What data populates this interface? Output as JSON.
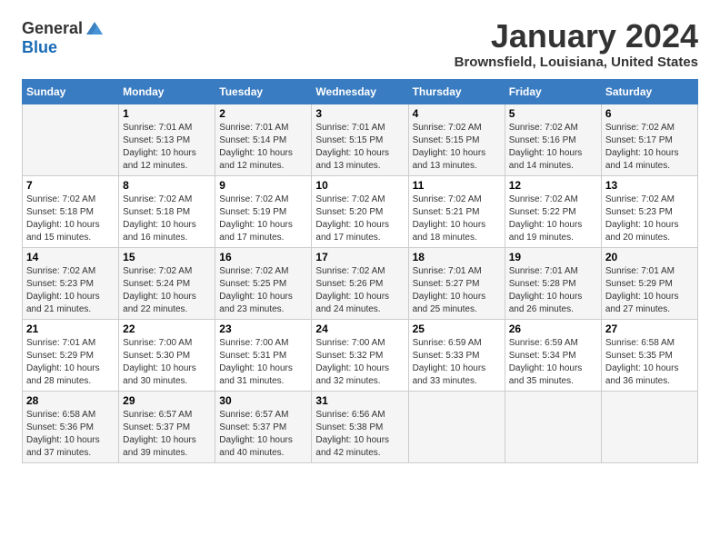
{
  "header": {
    "logo_general": "General",
    "logo_blue": "Blue",
    "month_year": "January 2024",
    "location": "Brownsfield, Louisiana, United States"
  },
  "weekdays": [
    "Sunday",
    "Monday",
    "Tuesday",
    "Wednesday",
    "Thursday",
    "Friday",
    "Saturday"
  ],
  "weeks": [
    [
      {
        "day": "",
        "info": ""
      },
      {
        "day": "1",
        "info": "Sunrise: 7:01 AM\nSunset: 5:13 PM\nDaylight: 10 hours\nand 12 minutes."
      },
      {
        "day": "2",
        "info": "Sunrise: 7:01 AM\nSunset: 5:14 PM\nDaylight: 10 hours\nand 12 minutes."
      },
      {
        "day": "3",
        "info": "Sunrise: 7:01 AM\nSunset: 5:15 PM\nDaylight: 10 hours\nand 13 minutes."
      },
      {
        "day": "4",
        "info": "Sunrise: 7:02 AM\nSunset: 5:15 PM\nDaylight: 10 hours\nand 13 minutes."
      },
      {
        "day": "5",
        "info": "Sunrise: 7:02 AM\nSunset: 5:16 PM\nDaylight: 10 hours\nand 14 minutes."
      },
      {
        "day": "6",
        "info": "Sunrise: 7:02 AM\nSunset: 5:17 PM\nDaylight: 10 hours\nand 14 minutes."
      }
    ],
    [
      {
        "day": "7",
        "info": "Sunrise: 7:02 AM\nSunset: 5:18 PM\nDaylight: 10 hours\nand 15 minutes."
      },
      {
        "day": "8",
        "info": "Sunrise: 7:02 AM\nSunset: 5:18 PM\nDaylight: 10 hours\nand 16 minutes."
      },
      {
        "day": "9",
        "info": "Sunrise: 7:02 AM\nSunset: 5:19 PM\nDaylight: 10 hours\nand 17 minutes."
      },
      {
        "day": "10",
        "info": "Sunrise: 7:02 AM\nSunset: 5:20 PM\nDaylight: 10 hours\nand 17 minutes."
      },
      {
        "day": "11",
        "info": "Sunrise: 7:02 AM\nSunset: 5:21 PM\nDaylight: 10 hours\nand 18 minutes."
      },
      {
        "day": "12",
        "info": "Sunrise: 7:02 AM\nSunset: 5:22 PM\nDaylight: 10 hours\nand 19 minutes."
      },
      {
        "day": "13",
        "info": "Sunrise: 7:02 AM\nSunset: 5:23 PM\nDaylight: 10 hours\nand 20 minutes."
      }
    ],
    [
      {
        "day": "14",
        "info": "Sunrise: 7:02 AM\nSunset: 5:23 PM\nDaylight: 10 hours\nand 21 minutes."
      },
      {
        "day": "15",
        "info": "Sunrise: 7:02 AM\nSunset: 5:24 PM\nDaylight: 10 hours\nand 22 minutes."
      },
      {
        "day": "16",
        "info": "Sunrise: 7:02 AM\nSunset: 5:25 PM\nDaylight: 10 hours\nand 23 minutes."
      },
      {
        "day": "17",
        "info": "Sunrise: 7:02 AM\nSunset: 5:26 PM\nDaylight: 10 hours\nand 24 minutes."
      },
      {
        "day": "18",
        "info": "Sunrise: 7:01 AM\nSunset: 5:27 PM\nDaylight: 10 hours\nand 25 minutes."
      },
      {
        "day": "19",
        "info": "Sunrise: 7:01 AM\nSunset: 5:28 PM\nDaylight: 10 hours\nand 26 minutes."
      },
      {
        "day": "20",
        "info": "Sunrise: 7:01 AM\nSunset: 5:29 PM\nDaylight: 10 hours\nand 27 minutes."
      }
    ],
    [
      {
        "day": "21",
        "info": "Sunrise: 7:01 AM\nSunset: 5:29 PM\nDaylight: 10 hours\nand 28 minutes."
      },
      {
        "day": "22",
        "info": "Sunrise: 7:00 AM\nSunset: 5:30 PM\nDaylight: 10 hours\nand 30 minutes."
      },
      {
        "day": "23",
        "info": "Sunrise: 7:00 AM\nSunset: 5:31 PM\nDaylight: 10 hours\nand 31 minutes."
      },
      {
        "day": "24",
        "info": "Sunrise: 7:00 AM\nSunset: 5:32 PM\nDaylight: 10 hours\nand 32 minutes."
      },
      {
        "day": "25",
        "info": "Sunrise: 6:59 AM\nSunset: 5:33 PM\nDaylight: 10 hours\nand 33 minutes."
      },
      {
        "day": "26",
        "info": "Sunrise: 6:59 AM\nSunset: 5:34 PM\nDaylight: 10 hours\nand 35 minutes."
      },
      {
        "day": "27",
        "info": "Sunrise: 6:58 AM\nSunset: 5:35 PM\nDaylight: 10 hours\nand 36 minutes."
      }
    ],
    [
      {
        "day": "28",
        "info": "Sunrise: 6:58 AM\nSunset: 5:36 PM\nDaylight: 10 hours\nand 37 minutes."
      },
      {
        "day": "29",
        "info": "Sunrise: 6:57 AM\nSunset: 5:37 PM\nDaylight: 10 hours\nand 39 minutes."
      },
      {
        "day": "30",
        "info": "Sunrise: 6:57 AM\nSunset: 5:37 PM\nDaylight: 10 hours\nand 40 minutes."
      },
      {
        "day": "31",
        "info": "Sunrise: 6:56 AM\nSunset: 5:38 PM\nDaylight: 10 hours\nand 42 minutes."
      },
      {
        "day": "",
        "info": ""
      },
      {
        "day": "",
        "info": ""
      },
      {
        "day": "",
        "info": ""
      }
    ]
  ]
}
